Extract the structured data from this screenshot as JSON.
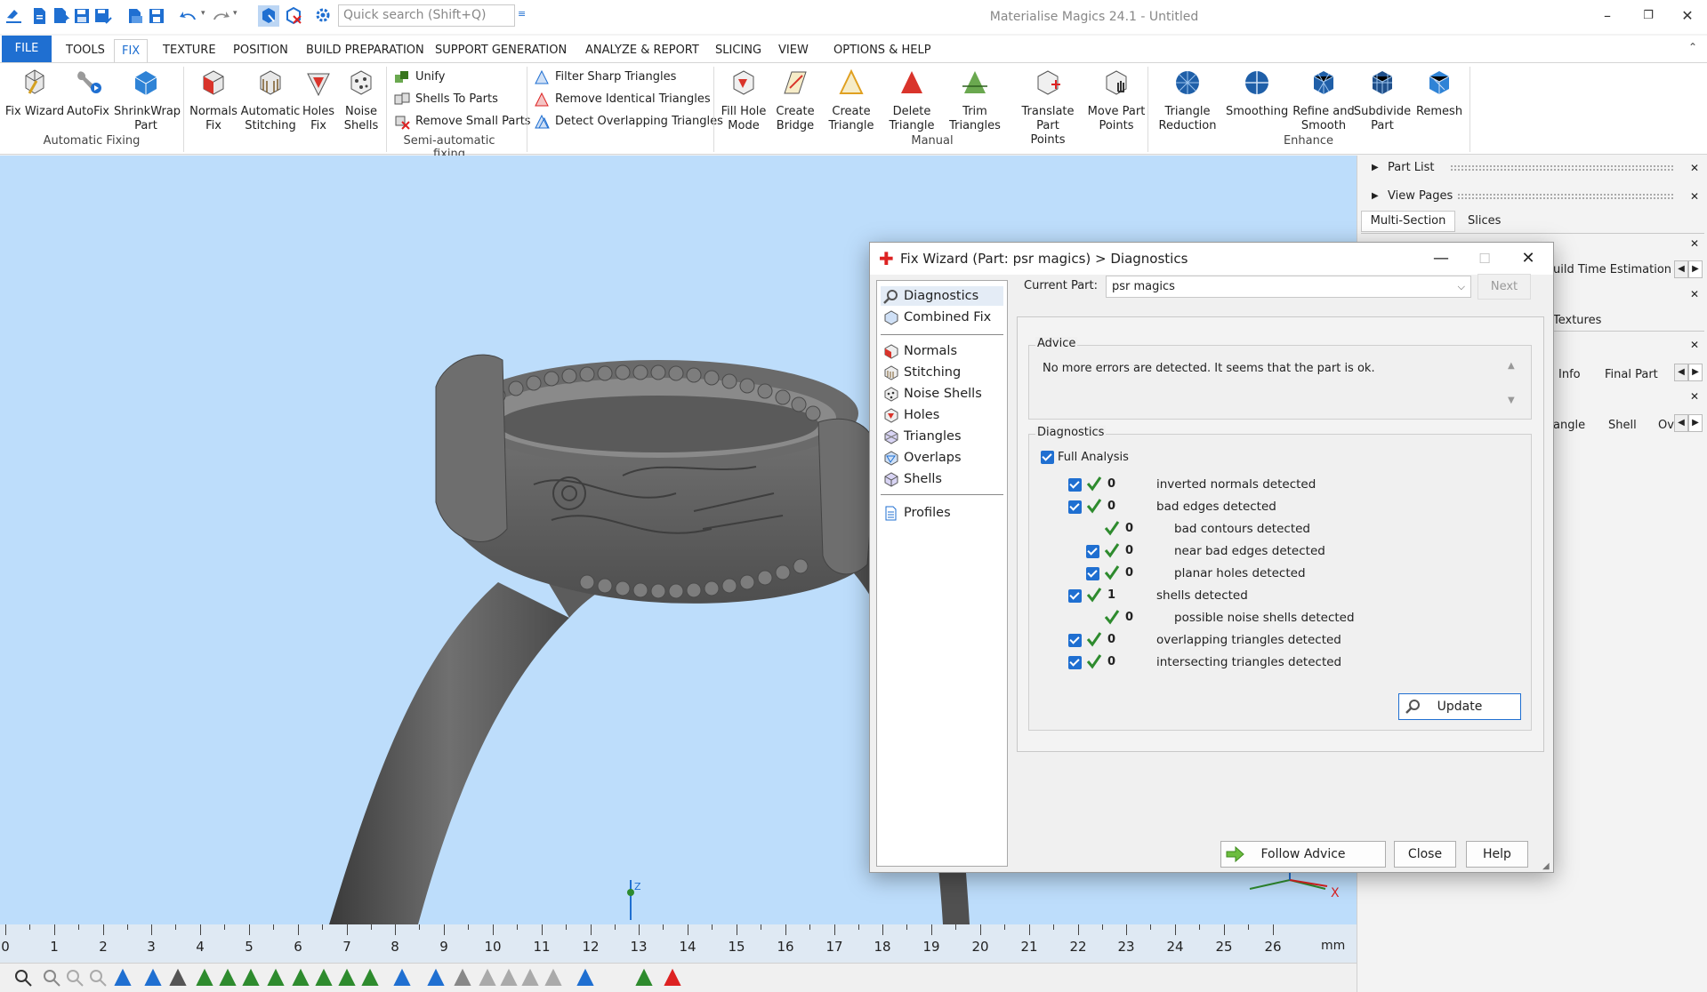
{
  "app": {
    "title": "Materialise Magics 24.1 - Untitled"
  },
  "quick_access": {
    "search_placeholder": "Quick search (Shift+Q)"
  },
  "ribbon_tabs": [
    "FILE",
    "TOOLS",
    "FIX",
    "TEXTURE",
    "POSITION",
    "BUILD PREPARATION",
    "SUPPORT GENERATION",
    "ANALYZE & REPORT",
    "SLICING",
    "VIEW",
    "OPTIONS & HELP"
  ],
  "ribbon": {
    "auto": {
      "group": "Automatic Fixing",
      "fix_wizard": "Fix Wizard",
      "autofix": "AutoFix",
      "shrinkwrap_1": "ShrinkWrap",
      "shrinkwrap_2": "Part"
    },
    "semi": {
      "group": "Semi-automatic fixing",
      "normals_1": "Normals",
      "normals_2": "Fix",
      "stitch_1": "Automatic",
      "stitch_2": "Stitching",
      "holes_1": "Holes",
      "holes_2": "Fix",
      "noise_1": "Noise",
      "noise_2": "Shells",
      "unify": "Unify",
      "shells_to_parts": "Shells To Parts",
      "remove_small": "Remove Small Parts",
      "filter_sharp": "Filter Sharp Triangles",
      "remove_identical": "Remove Identical Triangles",
      "detect_overlap": "Detect Overlapping Triangles"
    },
    "manual": {
      "group": "Manual",
      "fill_hole_1": "Fill Hole",
      "fill_hole_2": "Mode",
      "bridge_1": "Create",
      "bridge_2": "Bridge",
      "ctri_1": "Create",
      "ctri_2": "Triangle",
      "dtri_1": "Delete",
      "dtri_2": "Triangle",
      "trim_1": "Trim",
      "trim_2": "Triangles",
      "translate_1": "Translate Part",
      "translate_2": "Points",
      "move_1": "Move Part",
      "move_2": "Points"
    },
    "enhance": {
      "group": "Enhance",
      "tri_red_1": "Triangle",
      "tri_red_2": "Reduction",
      "smoothing": "Smoothing",
      "refine_1": "Refine and",
      "refine_2": "Smooth",
      "subdivide_1": "Subdivide",
      "subdivide_2": "Part",
      "remesh": "Remesh"
    }
  },
  "right_panel": {
    "part_list": "Part List",
    "view_pages": "View Pages",
    "tabs": [
      "Multi-Section",
      "Slices"
    ],
    "build_time": "uild Time Estimation",
    "textures": "Textures",
    "info_tabs": [
      "Info",
      "Final Part"
    ],
    "tri_tabs": [
      "angle",
      "Shell",
      "Ov"
    ]
  },
  "dialog": {
    "title": "Fix Wizard (Part: psr magics) > Diagnostics",
    "nav_top": [
      "Diagnostics",
      "Combined Fix"
    ],
    "nav_mid": [
      "Normals",
      "Stitching",
      "Noise Shells",
      "Holes",
      "Triangles",
      "Overlaps",
      "Shells"
    ],
    "nav_bottom": [
      "Profiles"
    ],
    "current_part_label": "Current Part:",
    "current_part_value": "psr magics",
    "next": "Next",
    "advice_legend": "Advice",
    "advice_text": "No more errors are detected. It seems that the part is ok.",
    "diag_legend": "Diagnostics",
    "full_analysis": "Full Analysis",
    "rows": [
      {
        "count": "0",
        "label": "inverted normals detected"
      },
      {
        "count": "0",
        "label": "bad edges detected"
      },
      {
        "count": "0",
        "label": "bad contours detected"
      },
      {
        "count": "0",
        "label": "near bad edges detected"
      },
      {
        "count": "0",
        "label": "planar holes detected"
      },
      {
        "count": "1",
        "label": "shells detected"
      },
      {
        "count": "0",
        "label": "possible noise shells detected"
      },
      {
        "count": "0",
        "label": "overlapping triangles detected"
      },
      {
        "count": "0",
        "label": "intersecting triangles detected"
      }
    ],
    "update": "Update",
    "follow_advice": "Follow Advice",
    "close": "Close",
    "help": "Help"
  },
  "ruler": {
    "unit": "mm",
    "labels": [
      "0",
      "1",
      "2",
      "3",
      "4",
      "5",
      "6",
      "7",
      "8",
      "9",
      "10",
      "11",
      "12",
      "13",
      "14",
      "15",
      "16",
      "17",
      "18",
      "19",
      "20",
      "21",
      "22",
      "23",
      "24",
      "25",
      "26"
    ]
  },
  "axis": {
    "z": "Z",
    "x": "X"
  },
  "colors": {
    "accent": "#1f6fd1",
    "viewport": "#bdddfb",
    "model": "#5e5e5e",
    "ok_check": "#2e8b2e"
  }
}
